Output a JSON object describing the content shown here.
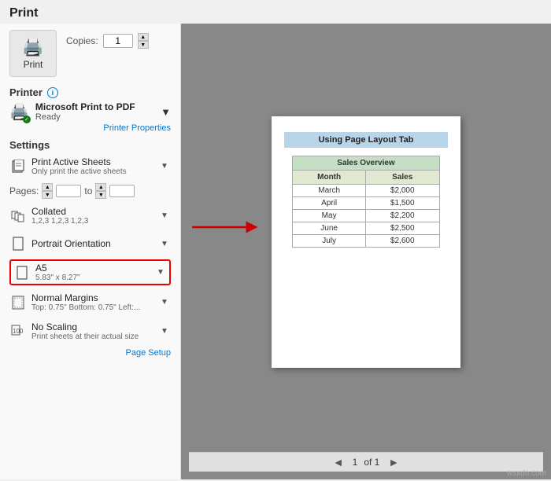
{
  "window": {
    "title": "Print"
  },
  "header": {
    "print_button_label": "Print",
    "copies_label": "Copies:",
    "copies_value": "1"
  },
  "printer_section": {
    "title": "Printer",
    "name": "Microsoft Print to PDF",
    "status": "Ready",
    "properties_link": "Printer Properties"
  },
  "settings_section": {
    "title": "Settings",
    "print_what": {
      "main": "Print Active Sheets",
      "sub": "Only print the active sheets"
    },
    "pages_label": "Pages:",
    "pages_from": "",
    "pages_to_label": "to",
    "pages_to": "",
    "collation": {
      "main": "Collated",
      "sub": "1,2,3   1,2,3   1,2,3"
    },
    "orientation": {
      "main": "Portrait Orientation",
      "sub": ""
    },
    "paper_size": {
      "main": "A5",
      "sub": "5.83\" x 8.27\""
    },
    "margins": {
      "main": "Normal Margins",
      "sub": "Top: 0.75\" Bottom: 0.75\" Left:..."
    },
    "scaling": {
      "main": "No Scaling",
      "sub": "Print sheets at their actual size"
    },
    "page_setup_link": "Page Setup"
  },
  "preview": {
    "page_title": "Using Page Layout Tab",
    "table": {
      "section_header": "Sales Overview",
      "col_headers": [
        "Month",
        "Sales"
      ],
      "rows": [
        [
          "March",
          "$2,000"
        ],
        [
          "April",
          "$1,500"
        ],
        [
          "May",
          "$2,200"
        ],
        [
          "June",
          "$2,500"
        ],
        [
          "July",
          "$2,600"
        ]
      ]
    }
  },
  "pagination": {
    "prev_label": "◄",
    "page_label": "1",
    "of_label": "of 1",
    "next_label": "►"
  },
  "watermark": "wsxdn.com"
}
